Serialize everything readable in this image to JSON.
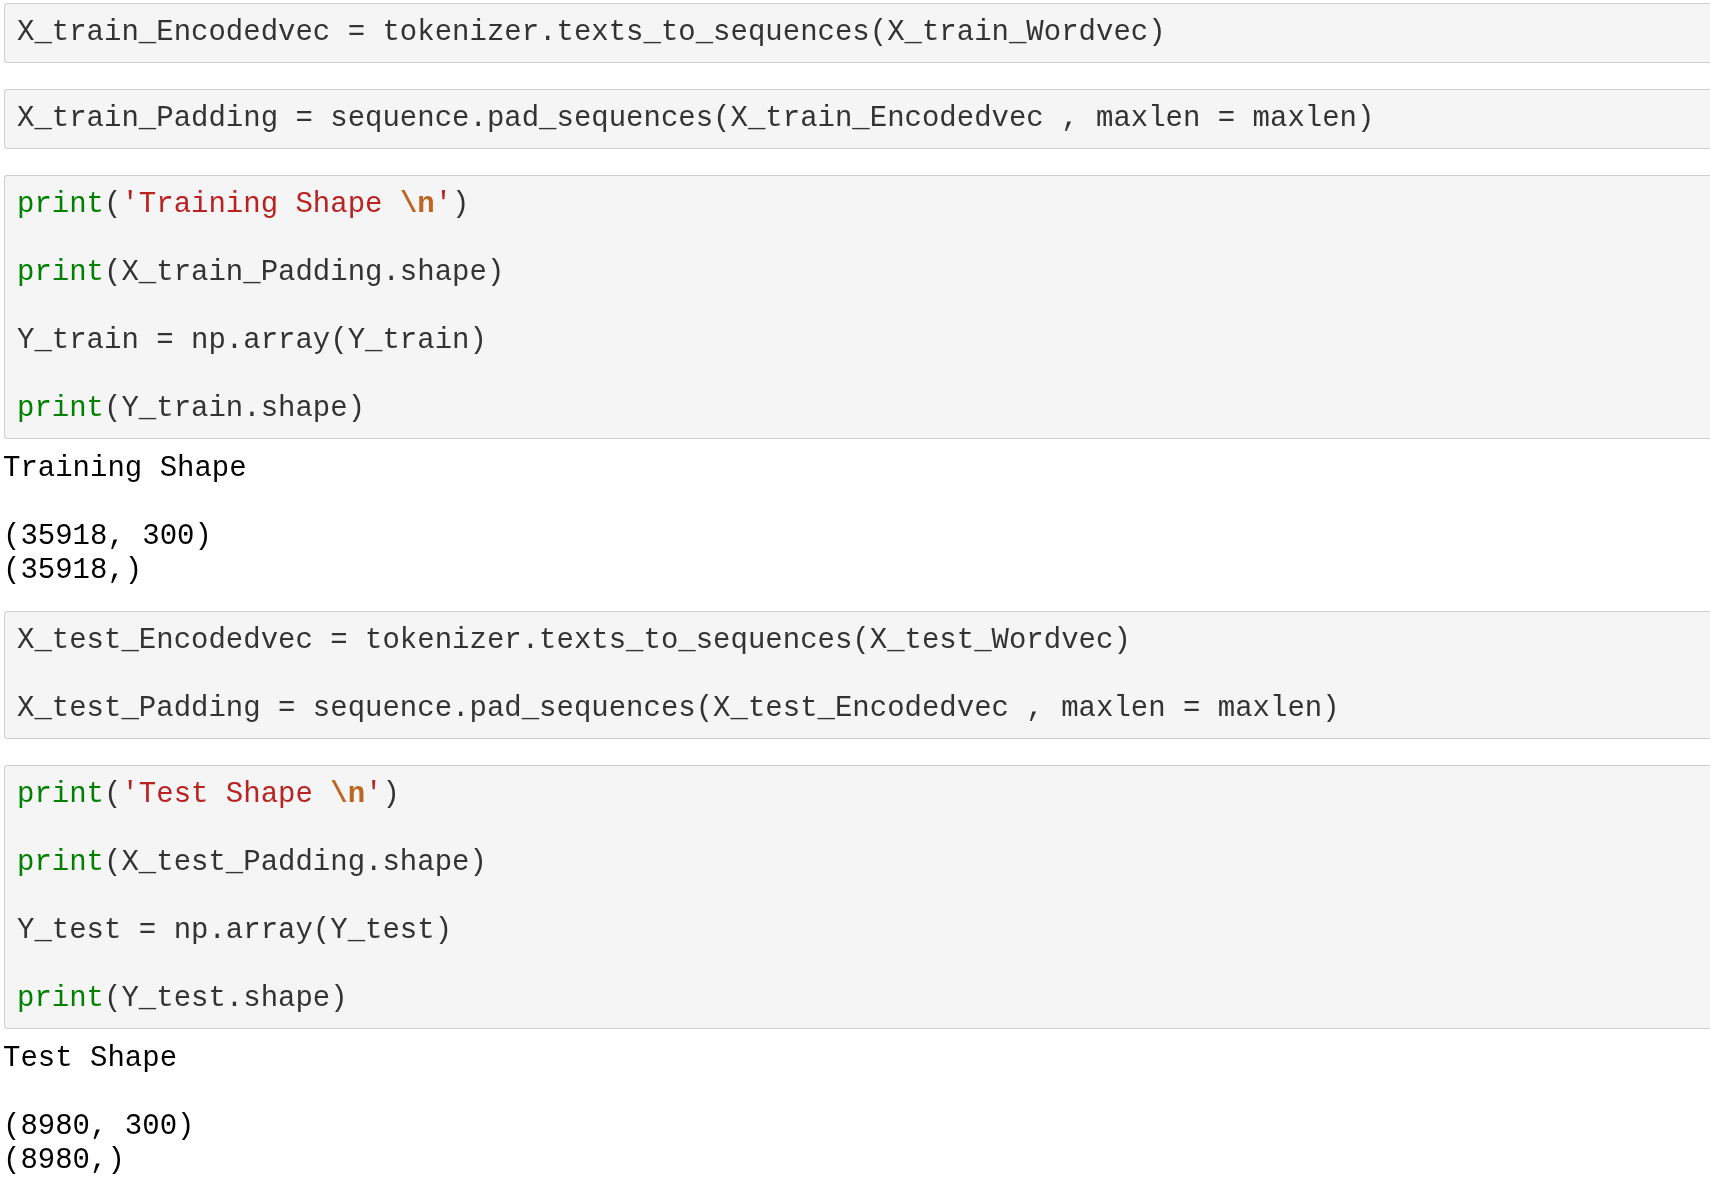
{
  "cells": [
    {
      "kind": "code",
      "statements": [
        [
          {
            "kind": "plain",
            "text": "X_train_Encodedvec = tokenizer.texts_to_sequences(X_train_Wordvec)"
          }
        ]
      ]
    },
    {
      "kind": "code",
      "statements": [
        [
          {
            "kind": "plain",
            "text": "X_train_Padding = sequence.pad_sequences(X_train_Encodedvec , maxlen = maxlen)"
          }
        ]
      ]
    },
    {
      "kind": "code",
      "statements": [
        [
          {
            "kind": "builtin",
            "text": "print"
          },
          {
            "kind": "plain",
            "text": "("
          },
          {
            "kind": "string",
            "text": "'Training Shape "
          },
          {
            "kind": "escape",
            "text": "\\n"
          },
          {
            "kind": "string",
            "text": "'"
          },
          {
            "kind": "plain",
            "text": ")"
          }
        ],
        [
          {
            "kind": "builtin",
            "text": "print"
          },
          {
            "kind": "plain",
            "text": "(X_train_Padding.shape)"
          }
        ],
        [
          {
            "kind": "plain",
            "text": "Y_train = np.array(Y_train)"
          }
        ],
        [
          {
            "kind": "builtin",
            "text": "print"
          },
          {
            "kind": "plain",
            "text": "(Y_train.shape)"
          }
        ]
      ]
    },
    {
      "kind": "output",
      "blocks": [
        [
          "Training Shape"
        ],
        [
          "(35918, 300)",
          "(35918,)"
        ]
      ]
    },
    {
      "kind": "code",
      "statements": [
        [
          {
            "kind": "plain",
            "text": "X_test_Encodedvec = tokenizer.texts_to_sequences(X_test_Wordvec)"
          }
        ],
        [
          {
            "kind": "plain",
            "text": "X_test_Padding = sequence.pad_sequences(X_test_Encodedvec , maxlen = maxlen)"
          }
        ]
      ]
    },
    {
      "kind": "code",
      "statements": [
        [
          {
            "kind": "builtin",
            "text": "print"
          },
          {
            "kind": "plain",
            "text": "("
          },
          {
            "kind": "string",
            "text": "'Test Shape "
          },
          {
            "kind": "escape",
            "text": "\\n"
          },
          {
            "kind": "string",
            "text": "'"
          },
          {
            "kind": "plain",
            "text": ")"
          }
        ],
        [
          {
            "kind": "builtin",
            "text": "print"
          },
          {
            "kind": "plain",
            "text": "(X_test_Padding.shape)"
          }
        ],
        [
          {
            "kind": "plain",
            "text": "Y_test = np.array(Y_test)"
          }
        ],
        [
          {
            "kind": "builtin",
            "text": "print"
          },
          {
            "kind": "plain",
            "text": "(Y_test.shape)"
          }
        ]
      ]
    },
    {
      "kind": "output",
      "blocks": [
        [
          "Test Shape"
        ],
        [
          "(8980, 300)",
          "(8980,)"
        ]
      ]
    }
  ]
}
